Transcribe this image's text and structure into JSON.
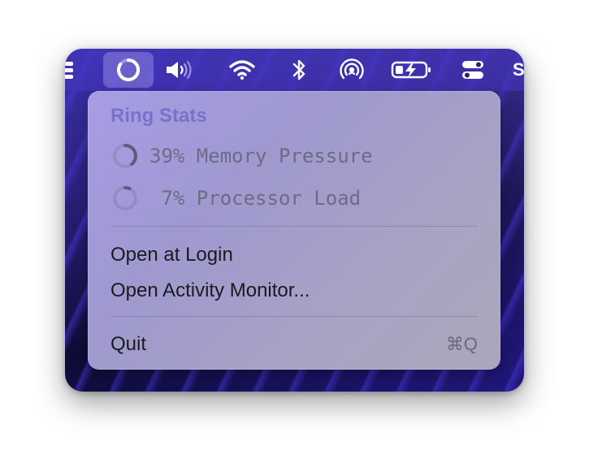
{
  "menubar": {
    "items": [
      {
        "name": "ring-stats-icon"
      },
      {
        "name": "volume-icon"
      },
      {
        "name": "wifi-icon"
      },
      {
        "name": "bluetooth-icon"
      },
      {
        "name": "airdrop-icon"
      },
      {
        "name": "battery-charging-icon"
      },
      {
        "name": "control-center-icon"
      }
    ],
    "partial_right_text": "S"
  },
  "menu": {
    "title": "Ring Stats",
    "stats": [
      {
        "label": "39% Memory Pressure",
        "percent": 39
      },
      {
        "label": " 7% Processor Load",
        "percent": 7
      }
    ],
    "items": [
      {
        "label": "Open at Login"
      },
      {
        "label": "Open Activity Monitor..."
      }
    ],
    "quit": {
      "label": "Quit",
      "shortcut": "⌘Q"
    }
  },
  "colors": {
    "accent": "#7b70cc",
    "menu_text": "#1a1a1f",
    "disabled_text": "#6e6a86"
  }
}
